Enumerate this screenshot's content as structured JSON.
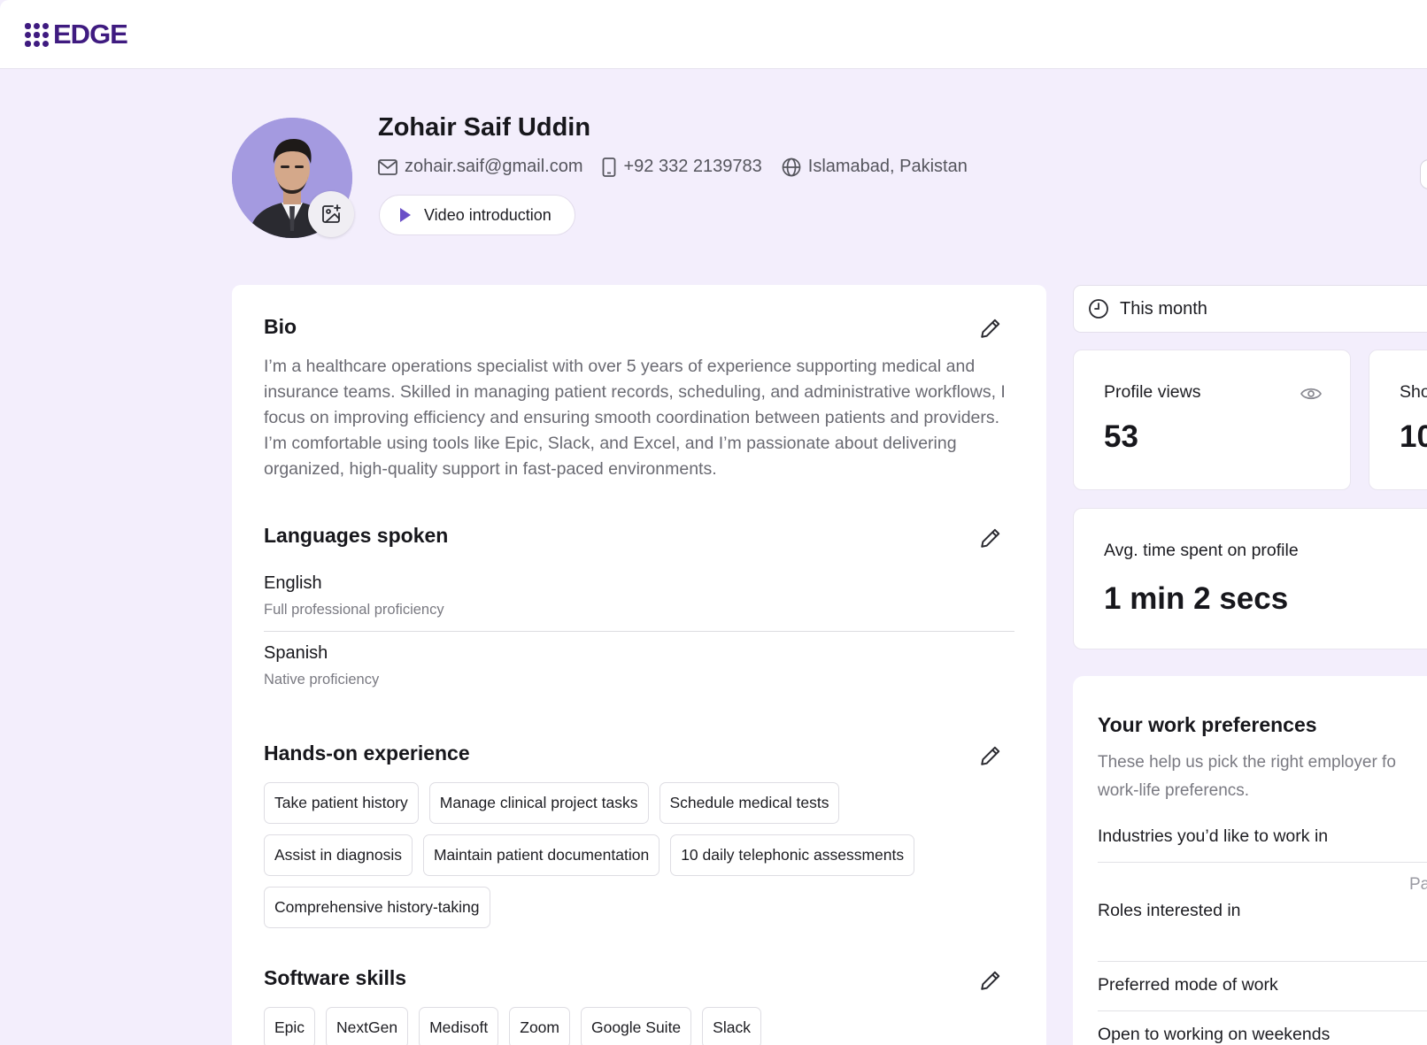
{
  "brand": {
    "name": "EDGE",
    "color": "#3f1b80"
  },
  "profile": {
    "name": "Zohair Saif Uddin",
    "email": "zohair.saif@gmail.com",
    "phone": "+92 332 2139783",
    "location": "Islamabad, Pakistan",
    "video_button": "Video introduction"
  },
  "bio": {
    "title": "Bio",
    "text": "I’m a healthcare operations specialist with over 5 years of experience supporting medical and insurance teams. Skilled in managing patient records, scheduling, and administrative workflows, I focus on improving efficiency and ensuring smooth coordination between patients and providers. I’m comfortable using tools like Epic, Slack, and Excel, and I’m passionate about delivering organized, high-quality support in fast-paced environments."
  },
  "languages": {
    "title": "Languages spoken",
    "items": [
      {
        "name": "English",
        "level": "Full professional proficiency"
      },
      {
        "name": "Spanish",
        "level": "Native proficiency"
      }
    ]
  },
  "experience": {
    "title": "Hands-on experience",
    "row1": [
      "Take patient history",
      "Manage clinical project tasks",
      "Schedule medical tests"
    ],
    "row2": [
      "Assist in diagnosis",
      "Maintain patient documentation",
      "10 daily telephonic assessments"
    ],
    "row3": [
      "Comprehensive history-taking"
    ]
  },
  "software": {
    "title": "Software skills",
    "items": [
      "Epic",
      "NextGen",
      "Medisoft",
      "Zoom",
      "Google Suite",
      "Slack"
    ]
  },
  "stats": {
    "period": "This month",
    "profile_views_label": "Profile views",
    "profile_views_value": "53",
    "second_label": "Sho",
    "second_value": "10",
    "avg_time_label": "Avg. time spent on profile",
    "avg_time_value": "1 min 2 secs"
  },
  "preferences": {
    "title": "Your work preferences",
    "description": "These help us pick the right employer fo\nwork-life preferencs.",
    "industries": "Industries you’d like to work in",
    "truncated": "Pa",
    "roles": "Roles interested in",
    "mode": "Preferred mode of work",
    "weekends": "Open to working on weekends"
  },
  "icons": {
    "edit": "pencil-icon",
    "mail": "mail-icon",
    "phone": "phone-icon",
    "globe": "globe-icon",
    "play": "play-icon",
    "clock": "clock-icon",
    "eye": "eye-icon",
    "camera": "image-add-icon"
  },
  "colors": {
    "background": "#f3eefc",
    "accent": "#6a4fc7"
  }
}
